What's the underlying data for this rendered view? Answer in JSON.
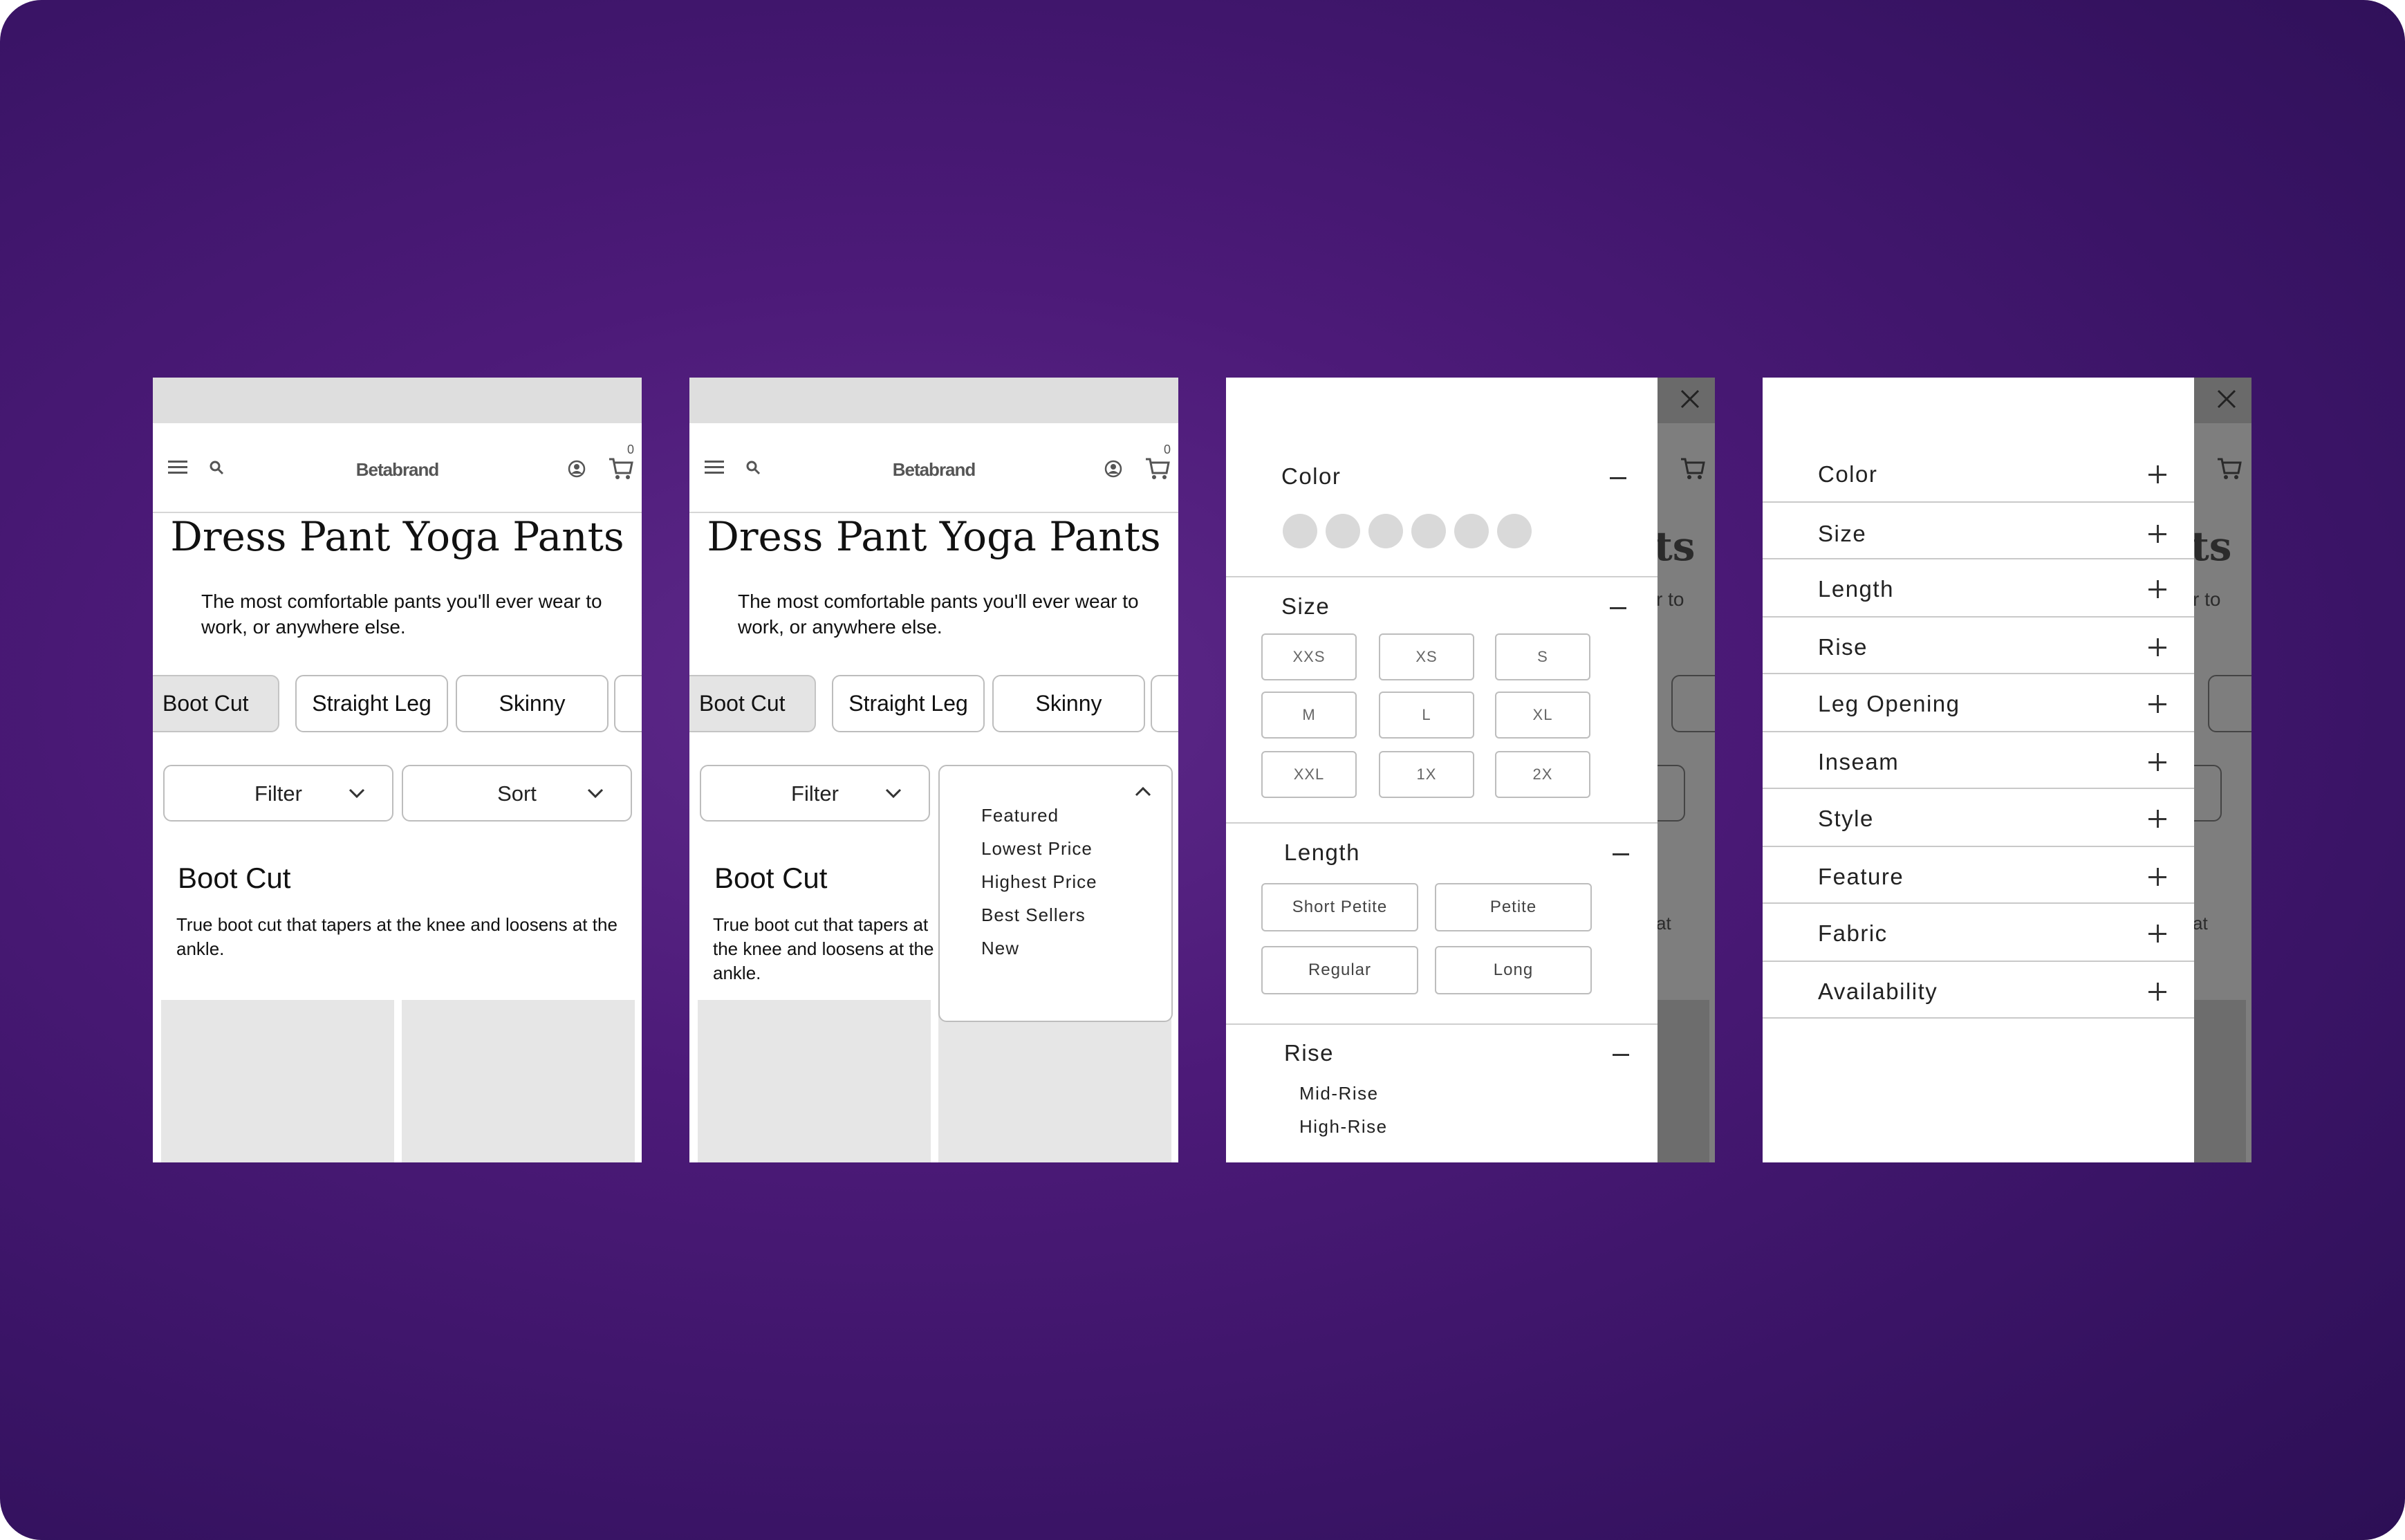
{
  "brand": "Betabrand",
  "cart_count": "0",
  "page": {
    "title": "Dress Pant Yoga Pants",
    "subtitle": "The most comfortable pants you'll ever wear to work, or anywhere else."
  },
  "style_chips": [
    "Boot Cut",
    "Straight Leg",
    "Skinny"
  ],
  "controls": {
    "filter_label": "Filter",
    "sort_label": "Sort"
  },
  "section": {
    "title": "Boot Cut",
    "description": "True boot cut that tapers at the knee and loosens at the ankle."
  },
  "sort_options": [
    "Featured",
    "Lowest Price",
    "Highest Price",
    "Best Sellers",
    "New"
  ],
  "filter_drawer": {
    "color_label": "Color",
    "size_label": "Size",
    "sizes": [
      "XXS",
      "XS",
      "S",
      "M",
      "L",
      "XL",
      "XXL",
      "1X",
      "2X"
    ],
    "length_label": "Length",
    "lengths": [
      "Short Petite",
      "Petite",
      "Regular",
      "Long"
    ],
    "rise_label": "Rise",
    "rises": [
      "Mid-Rise",
      "High-Rise"
    ]
  },
  "filter_categories": [
    "Color",
    "Size",
    "Length",
    "Rise",
    "Leg Opening",
    "Inseam",
    "Style",
    "Feature",
    "Fabric",
    "Availability"
  ],
  "ghost_text": {
    "title_tail": "ts",
    "subtitle_tail": "r to",
    "desc_tail": "at"
  },
  "colors": {
    "background": "#4c1a78",
    "chip_active": "#e4e4e4",
    "placeholder": "#e6e6e6",
    "overlay": "#7e7e7e",
    "swatch": "#d9d9d9"
  }
}
